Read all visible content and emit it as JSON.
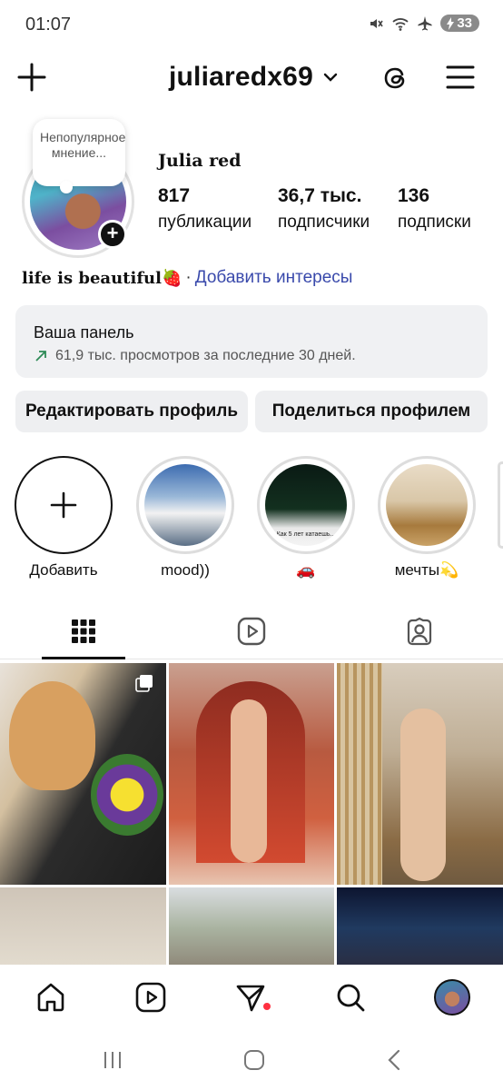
{
  "status_bar": {
    "time": "01:07",
    "battery": "33"
  },
  "header": {
    "username": "juliaredx69"
  },
  "profile": {
    "note": "Непопулярное мнение...",
    "display_name": "Julia red",
    "stats": [
      {
        "value": "817",
        "label": "публикации"
      },
      {
        "value": "36,7 тыс.",
        "label": "подписчики"
      },
      {
        "value": "136",
        "label": "подписки"
      }
    ],
    "bio": "life is beautiful🍓",
    "bio_separator": "·",
    "add_interests": "Добавить интересы"
  },
  "dashboard": {
    "title": "Ваша панель",
    "subtitle": "61,9 тыс. просмотров за последние 30 дней."
  },
  "buttons": {
    "edit": "Редактировать профиль",
    "share": "Поделиться профилем"
  },
  "highlights": [
    {
      "label": "Добавить"
    },
    {
      "label": "mood))"
    },
    {
      "label": "🚗",
      "caption": "Как 5 лет катаешь..."
    },
    {
      "label": "мечты💫"
    }
  ],
  "colors": {
    "link": "#3949ab",
    "notification": "#ff3040",
    "button_bg": "#eeeff1"
  }
}
